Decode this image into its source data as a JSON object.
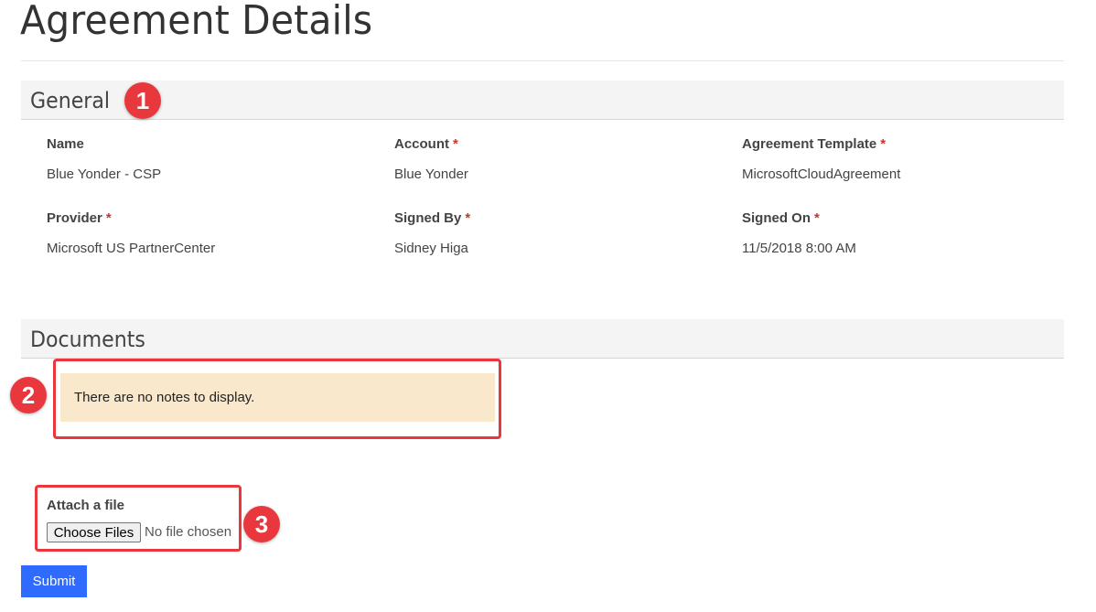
{
  "page": {
    "title": "Agreement Details"
  },
  "general": {
    "heading": "General",
    "badge": "1",
    "fields": [
      {
        "label": "Name",
        "required": "",
        "value": "Blue Yonder - CSP"
      },
      {
        "label": "Account",
        "required": "*",
        "value": "Blue Yonder"
      },
      {
        "label": "Agreement Template",
        "required": "*",
        "value": "MicrosoftCloudAgreement"
      },
      {
        "label": "Provider",
        "required": "*",
        "value": "Microsoft US PartnerCenter"
      },
      {
        "label": "Signed By",
        "required": "*",
        "value": "Sidney Higa"
      },
      {
        "label": "Signed On",
        "required": "*",
        "value": "11/5/2018 8:00 AM"
      }
    ]
  },
  "documents": {
    "heading": "Documents",
    "badge": "2",
    "empty_message": "There are no notes to display."
  },
  "attach": {
    "badge": "3",
    "label": "Attach a file",
    "button_label": "Choose Files",
    "status": "No file chosen"
  },
  "submit": {
    "label": "Submit"
  },
  "colors": {
    "accent": "#2f6bff",
    "highlight": "#e8383d",
    "notes_background": "#f9e8cc",
    "section_background": "#f4f4f4"
  }
}
